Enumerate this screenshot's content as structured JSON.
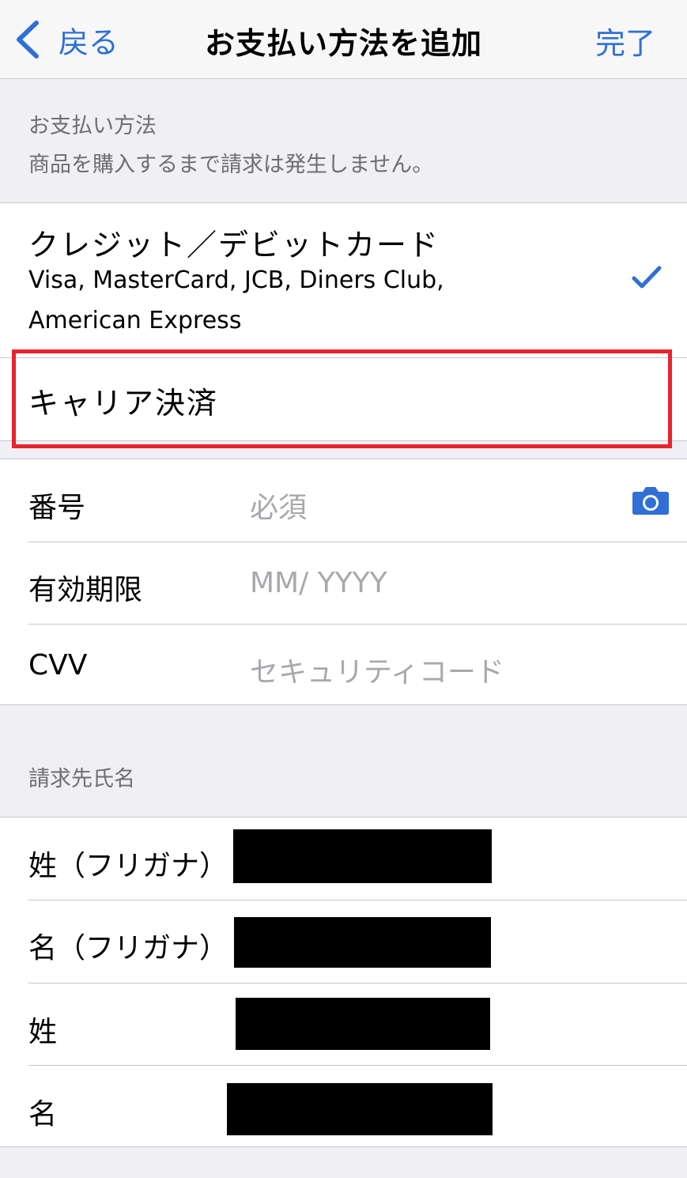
{
  "nav": {
    "back_label": "戻る",
    "title": "お支払い方法を追加",
    "done_label": "完了"
  },
  "payment_section": {
    "header_line1": "お支払い方法",
    "header_line2": "商品を購入するまで請求は発生しません。"
  },
  "payment_options": [
    {
      "title": "クレジット／デビットカード",
      "subtitle_line1": "Visa, MasterCard, JCB, Diners Club,",
      "subtitle_line2": "American Express",
      "selected": true
    },
    {
      "title": "キャリア決済",
      "selected": false
    }
  ],
  "card_fields": {
    "number": {
      "label": "番号",
      "placeholder": "必須"
    },
    "expiry": {
      "label": "有効期限",
      "placeholder": "MM/ YYYY"
    },
    "cvv": {
      "label": "CVV",
      "placeholder": "セキュリティコード"
    }
  },
  "billing_section": {
    "header": "請求先氏名",
    "rows": [
      {
        "label": "姓（フリガナ）"
      },
      {
        "label": "名（フリガナ）"
      },
      {
        "label": "姓"
      },
      {
        "label": "名"
      }
    ]
  },
  "colors": {
    "accent": "#2f6fd6",
    "highlight_border": "#e8242c",
    "background": "#efeff4",
    "placeholder": "#a8a8ad"
  },
  "icons": {
    "back": "chevron-left-icon",
    "check": "checkmark-icon",
    "camera": "camera-icon"
  }
}
